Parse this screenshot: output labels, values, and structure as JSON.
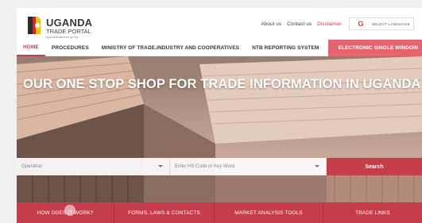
{
  "brand": {
    "title": "UGANDA",
    "subtitle": "TRADE PORTAL",
    "url": "ugandatradeinfo.go.ug"
  },
  "toplinks": {
    "about": "About us",
    "contact": "Contact us",
    "disclaimer": "Disclaimer",
    "language": "SELECT LANGUAGE"
  },
  "nav": {
    "items": [
      {
        "label": "HOME"
      },
      {
        "label": "PROCEDURES"
      },
      {
        "label": "MINISTRY OF TRADE,INDUSTRY AND COOPERATIVES"
      },
      {
        "label": "NTB REPORTING SYSTEM"
      },
      {
        "label": "ELECTRONIC SINGLE WINDOW"
      }
    ]
  },
  "hero": {
    "title": "OUR ONE STOP SHOP FOR TRADE INFORMATION IN UGANDA"
  },
  "search": {
    "operation_placeholder": "Operation",
    "hs_placeholder": "Enter HS Code or Key Word",
    "button": "Search"
  },
  "tabs": [
    {
      "label": "HOW DOES IT WORK?"
    },
    {
      "label": "FORMS, LAWS & CONTACTS"
    },
    {
      "label": "MARKET ANALYSIS TOOLS"
    },
    {
      "label": "TRADE LINKS"
    }
  ],
  "colors": {
    "accent": "#c53d4b",
    "accent_light": "#e36371"
  },
  "icons": {
    "logo": "uganda-flag-emblem-icon",
    "google": "google-g-icon",
    "caret": "chevron-down-icon"
  }
}
